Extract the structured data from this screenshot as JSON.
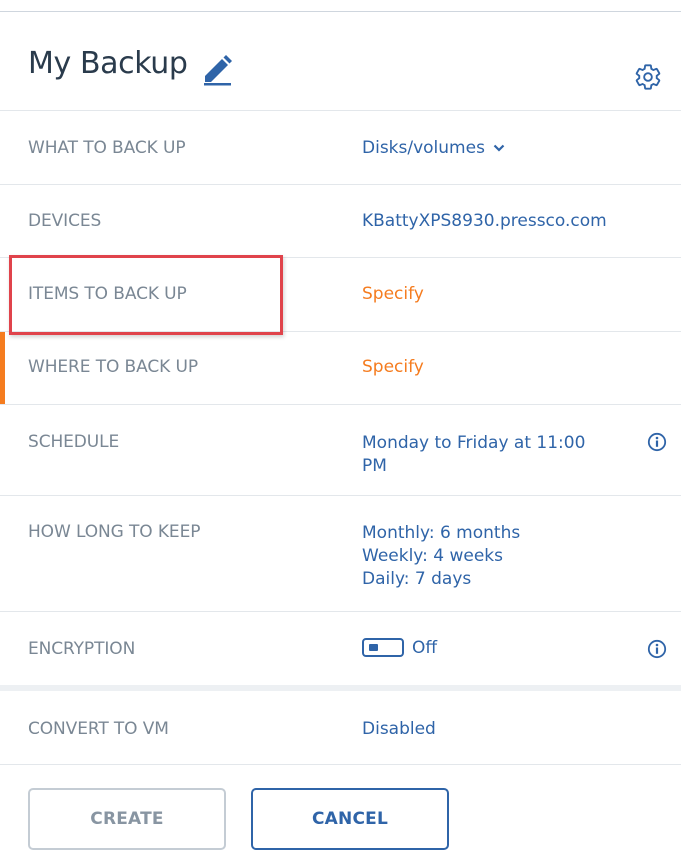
{
  "header": {
    "title": "My Backup",
    "edit_icon": "pencil-icon",
    "settings_icon": "gear-icon"
  },
  "rows": {
    "what_to_back_up": {
      "label": "WHAT TO BACK UP",
      "value": "Disks/volumes",
      "icon": "chevron-down-icon"
    },
    "devices": {
      "label": "DEVICES",
      "value": "KBattyXPS8930.pressco.com"
    },
    "items_to_back_up": {
      "label": "ITEMS TO BACK UP",
      "value": "Specify"
    },
    "where_to_back_up": {
      "label": "WHERE TO BACK UP",
      "value": "Specify"
    },
    "schedule": {
      "label": "SCHEDULE",
      "value_line1": "Monday to Friday at 11:00",
      "value_line2": "PM",
      "icon": "info-icon"
    },
    "how_long_to_keep": {
      "label": "HOW LONG TO KEEP",
      "monthly": "Monthly: 6 months",
      "weekly": "Weekly: 4 weeks",
      "daily": "Daily: 7 days"
    },
    "encryption": {
      "label": "ENCRYPTION",
      "toggle_state": "Off",
      "icon": "info-icon"
    },
    "convert_to_vm": {
      "label": "CONVERT TO VM",
      "value": "Disabled"
    }
  },
  "buttons": {
    "create": "CREATE",
    "cancel": "CANCEL"
  },
  "colors": {
    "link_blue": "#2f64a8",
    "warning_orange": "#f57c1f",
    "highlight_red": "#e0434b",
    "label_gray": "#7a8794",
    "title_dark": "#2a3b4c"
  }
}
